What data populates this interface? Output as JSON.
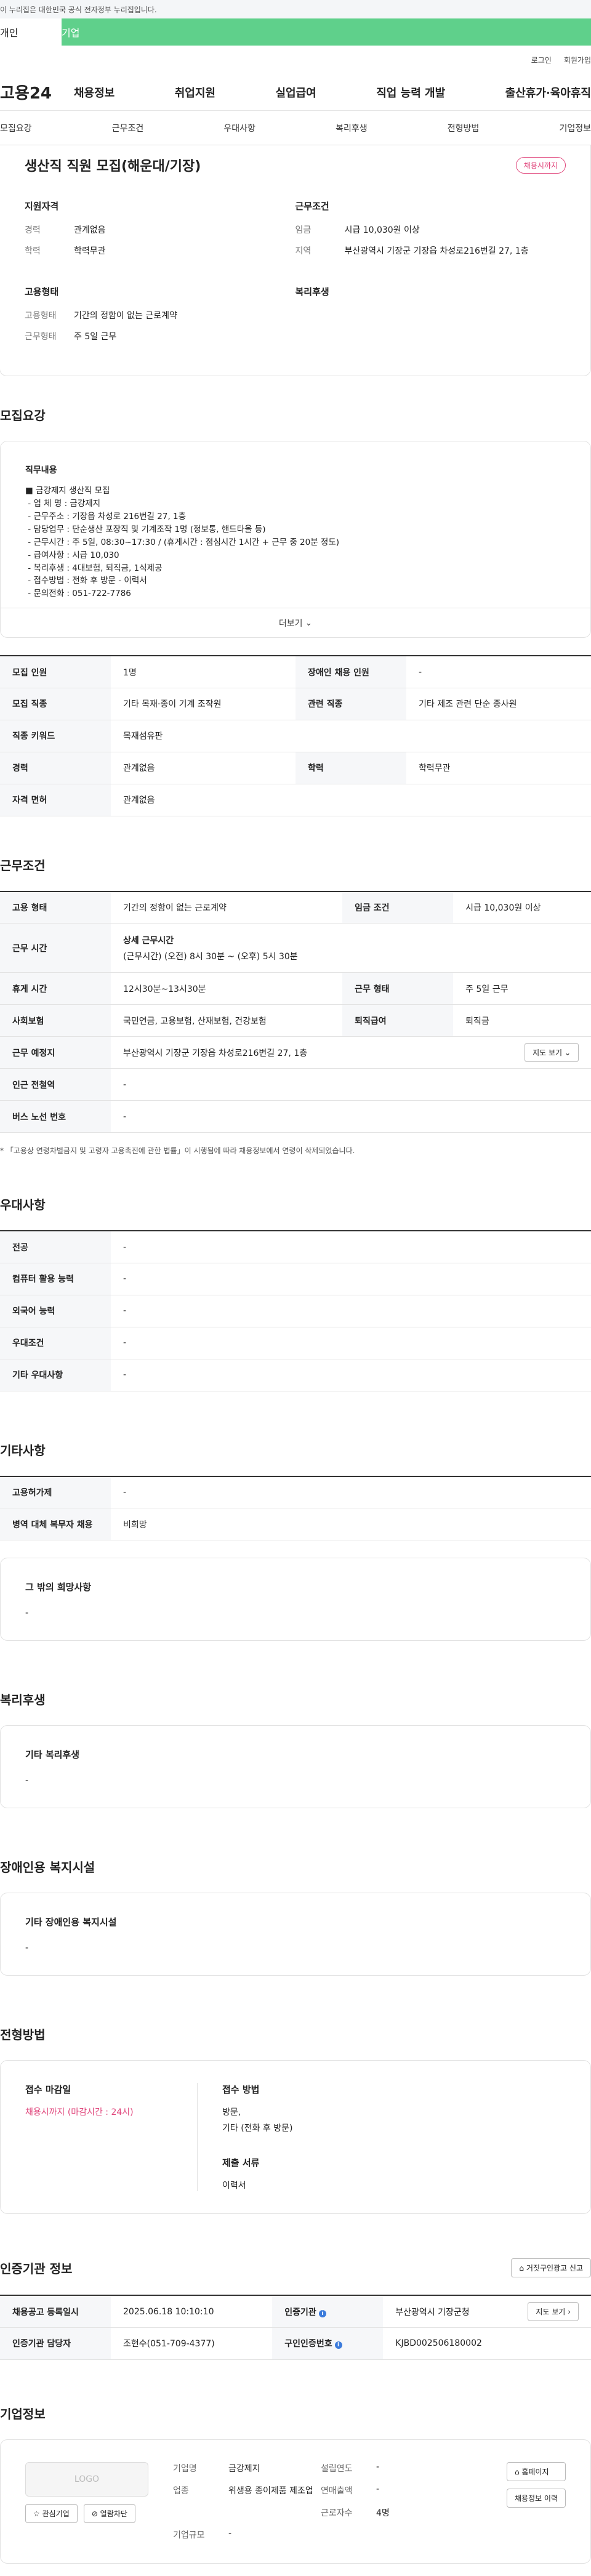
{
  "topbar": {
    "gov_notice": "이 누리집은 대한민국 공식 전자정부 누리집입니다."
  },
  "audience_tabs": [
    "개인",
    "기업"
  ],
  "auth": {
    "login": "로그인",
    "signup": "회원가입"
  },
  "gnb": {
    "logo": "고용24",
    "menu": [
      "채용정보",
      "취업지원",
      "실업급여",
      "직업 능력 개발",
      "출산휴가·육아휴직"
    ]
  },
  "subnav": [
    "모집요강",
    "근무조건",
    "우대사항",
    "복리후생",
    "전형방법",
    "기업정보"
  ],
  "job": {
    "title": "생산직 직원 모집(해운대/기장)",
    "badge": "채용시까지",
    "qual": {
      "heading": "지원자격",
      "rows": [
        [
          "경력",
          "관계없음"
        ],
        [
          "학력",
          "학력무관"
        ]
      ]
    },
    "emp": {
      "heading": "고용형태",
      "rows": [
        [
          "고용형태",
          "기간의 정함이 없는 근로계약"
        ],
        [
          "근무형태",
          "주 5일 근무"
        ]
      ]
    },
    "cond": {
      "heading": "근무조건",
      "rows": [
        [
          "임금",
          "시급 10,030원 이상"
        ],
        [
          "지역",
          "부산광역시 기장군 기장읍 차성로216번길 27, 1층"
        ]
      ]
    },
    "welfare": {
      "heading": "복리후생"
    }
  },
  "recruit": {
    "heading": "모집요강",
    "duty_heading": "직무내용",
    "duty_text": "■ 금강제지 생산직 모집\n - 업 체 명 : 금강제지\n - 근무주소 : 기장읍 차성로 216번길 27, 1층\n - 담당업무 : 단순생산 포장직 및 기계조작 1명 (정보통, 핸드타올 등)\n - 근무시간 : 주 5일, 08:30~17:30 / (휴게시간 : 점심시간 1시간 + 근무 중 20분 정도)\n - 급여사항 : 시급 10,030\n - 복리후생 : 4대보험, 퇴직금, 1식제공\n - 접수방법 : 전화 후 방문 - 이력서\n - 문의전화 : 051-722-7786",
    "more": "더보기",
    "table": [
      [
        [
          "모집 인원",
          "1명"
        ],
        [
          "장애인 채용 인원",
          "-"
        ]
      ],
      [
        [
          "모집 직종",
          "기타 목재·종이 기계 조작원"
        ],
        [
          "관련 직종",
          "기타 제조 관련 단순 종사원"
        ]
      ],
      [
        [
          "직종 키워드",
          "목재섬유판"
        ]
      ],
      [
        [
          "경력",
          "관계없음"
        ],
        [
          "학력",
          "학력무관"
        ]
      ],
      [
        [
          "자격 면허",
          "관계없음"
        ]
      ]
    ]
  },
  "work": {
    "heading": "근무조건",
    "emp_type": [
      "고용 형태",
      "기간의 정함이 없는 근로계약"
    ],
    "wage": [
      "임금 조건",
      "시급 10,030원 이상"
    ],
    "hours_label": "근무 시간",
    "hours_title": "상세 근무시간",
    "hours_value": "(근무시간) (오전) 8시 30분 ~ (오후) 5시 30분",
    "break": [
      "휴게 시간",
      "12시30분~13시30분"
    ],
    "work_type": [
      "근무 형태",
      "주 5일 근무"
    ],
    "insurance": [
      "사회보험",
      "국민연금, 고용보험, 산재보험, 건강보험"
    ],
    "severance": [
      "퇴직급여",
      "퇴직금"
    ],
    "location_label": "근무 예정지",
    "location": "부산광역시 기장군 기장읍 차성로216번길 27, 1층",
    "map_btn": "지도 보기",
    "station": [
      "인근 전철역",
      "-"
    ],
    "bus": [
      "버스 노선 번호",
      "-"
    ],
    "note": "* 「고용상 연령차별금지 및 고령자 고용촉진에 관한 법률」이 시행됨에 따라 채용정보에서 연령이 삭제되었습니다."
  },
  "pref": {
    "heading": "우대사항",
    "rows": [
      [
        "전공",
        "-"
      ],
      [
        "컴퓨터 활용 능력",
        "-"
      ],
      [
        "외국어 능력",
        "-"
      ],
      [
        "우대조건",
        "-"
      ],
      [
        "기타 우대사항",
        "-"
      ]
    ]
  },
  "etc": {
    "heading": "기타사항",
    "rows": [
      [
        "고용허가제",
        "-"
      ],
      [
        "병역 대체 복무자 채용",
        "비희망"
      ]
    ],
    "box_title": "그 밖의 희망사항",
    "box_value": "-"
  },
  "welfare": {
    "heading": "복리후생",
    "box_title": "기타 복리후생",
    "box_value": "-"
  },
  "disabled": {
    "heading": "장애인용 복지시설",
    "box_title": "기타 장애인용 복지시설",
    "box_value": "-"
  },
  "process": {
    "heading": "전형방법",
    "deadline_title": "접수 마감일",
    "deadline_value": "채용시까지 (마감시간 : 24시)",
    "method_title": "접수 방법",
    "method_value": "방문,",
    "method_value2": "기타 (전화 후 방문)",
    "docs_title": "제출 서류",
    "docs_value": "이력서"
  },
  "cert": {
    "heading": "인증기관 정보",
    "report_btn": "거짓구인광고 신고",
    "reg_date": [
      "채용공고 등록일시",
      "2025.06.18 10:10:10"
    ],
    "agency": [
      "인증기관",
      "부산광역시 기장군청"
    ],
    "map_btn": "지도 보기",
    "manager": [
      "인증기관 담당자",
      "조현수(051-709-4377)"
    ],
    "cert_no": [
      "구인인증번호",
      "KJBD002506180002"
    ]
  },
  "company": {
    "heading": "기업정보",
    "logo": "LOGO",
    "fav_btn": "관심기업",
    "block_btn": "열람차단",
    "name": [
      "기업명",
      "금강제지"
    ],
    "year": [
      "설립연도",
      "-"
    ],
    "industry": [
      "업종",
      "위생용 종이제품 제조업"
    ],
    "sales": [
      "연매출액",
      "-"
    ],
    "employees": [
      "근로자수",
      "4명"
    ],
    "size": [
      "기업규모",
      "-"
    ],
    "home_btn": "홈페이지",
    "hire_btn": "채용정보 이력"
  }
}
